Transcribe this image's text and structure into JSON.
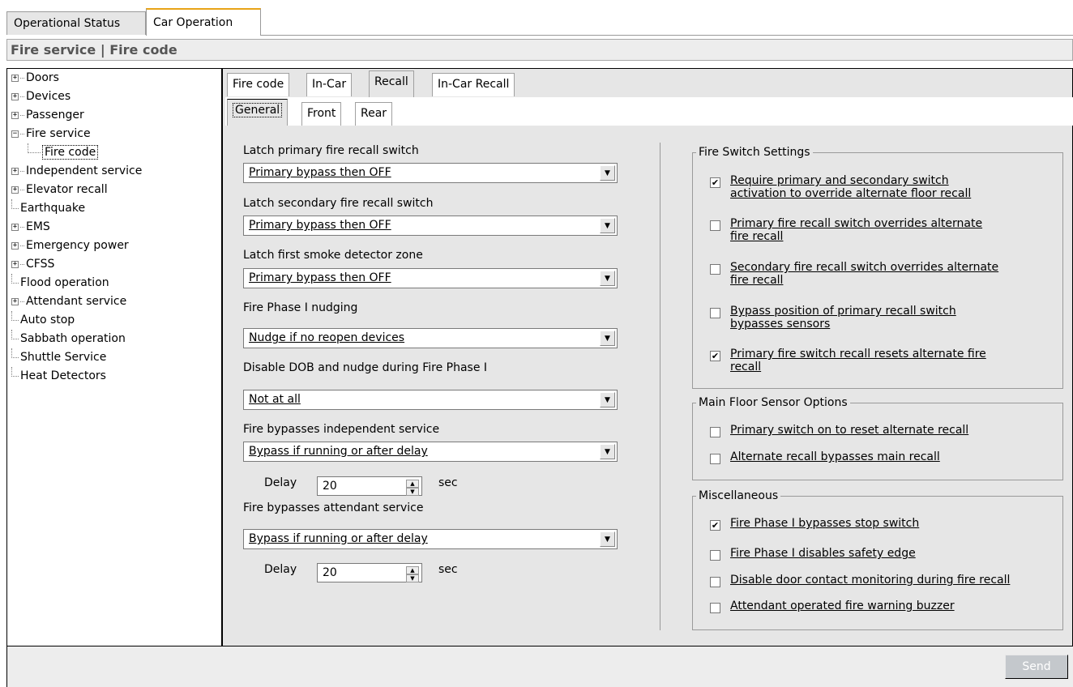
{
  "top_tabs": [
    {
      "label": "Operational Status",
      "active": false
    },
    {
      "label": "Car Operation",
      "active": true
    }
  ],
  "breadcrumb": "Fire service | Fire code",
  "tree": [
    {
      "label": "Doors",
      "kind": "expand"
    },
    {
      "label": "Devices",
      "kind": "expand"
    },
    {
      "label": "Passenger",
      "kind": "expand"
    },
    {
      "label": "Fire service",
      "kind": "collapse"
    },
    {
      "label": "Fire code",
      "kind": "child",
      "selected": true
    },
    {
      "label": "Independent service",
      "kind": "expand"
    },
    {
      "label": "Elevator recall",
      "kind": "expand"
    },
    {
      "label": "Earthquake",
      "kind": "leaf"
    },
    {
      "label": "EMS",
      "kind": "expand"
    },
    {
      "label": "Emergency power",
      "kind": "expand"
    },
    {
      "label": "CFSS",
      "kind": "expand"
    },
    {
      "label": "Flood operation",
      "kind": "leaf"
    },
    {
      "label": "Attendant service",
      "kind": "expand"
    },
    {
      "label": "Auto stop",
      "kind": "leaf"
    },
    {
      "label": "Sabbath operation",
      "kind": "leaf"
    },
    {
      "label": "Shuttle Service",
      "kind": "leaf"
    },
    {
      "label": "Heat Detectors",
      "kind": "leaf"
    }
  ],
  "tabs": [
    {
      "label": "Fire code",
      "active": false
    },
    {
      "label": "In-Car",
      "active": false
    },
    {
      "label": "Recall",
      "active": true
    },
    {
      "label": "In-Car Recall",
      "active": false
    }
  ],
  "subtabs": [
    {
      "label": "General",
      "active": true
    },
    {
      "label": "Front",
      "active": false
    },
    {
      "label": "Rear",
      "active": false
    }
  ],
  "settings": {
    "latch_primary": {
      "label": "Latch primary fire recall switch",
      "value": "Primary bypass then OFF"
    },
    "latch_secondary": {
      "label": "Latch secondary fire recall switch",
      "value": "Primary bypass then OFF"
    },
    "latch_smoke": {
      "label": "Latch first smoke detector zone",
      "value": "Primary bypass then OFF"
    },
    "nudging": {
      "label": "Fire Phase I nudging",
      "value": "Nudge if no reopen devices"
    },
    "disable_dob": {
      "label": "Disable DOB and nudge during Fire Phase I",
      "value": "Not at all"
    },
    "bypass_independent": {
      "label": "Fire bypasses independent service",
      "value": "Bypass if running or after delay"
    },
    "delay1": {
      "label": "Delay",
      "value": "20",
      "unit": "sec"
    },
    "bypass_attendant": {
      "label": "Fire bypasses attendant service",
      "value": "Bypass if running or after delay"
    },
    "delay2": {
      "label": "Delay",
      "value": "20",
      "unit": "sec"
    }
  },
  "fire_switch": {
    "title": "Fire Switch Settings",
    "items": [
      {
        "line1": "Require primary and secondary switch",
        "line2": "activation to override alternate floor recall",
        "checked": true
      },
      {
        "line1": "Primary fire recall switch overrides alternate",
        "line2": "fire recall",
        "checked": false
      },
      {
        "line1": "Secondary fire recall switch overrides alternate",
        "line2": "fire recall",
        "checked": false
      },
      {
        "line1": "Bypass position of primary recall switch",
        "line2": "bypasses sensors",
        "checked": false
      },
      {
        "line1": "Primary fire switch recall resets alternate fire",
        "line2": "recall",
        "checked": true
      }
    ]
  },
  "main_floor": {
    "title": "Main Floor Sensor Options",
    "items": [
      {
        "label": "Primary switch on to reset alternate recall",
        "checked": false
      },
      {
        "label": "Alternate recall bypasses main recall",
        "checked": false
      }
    ]
  },
  "misc": {
    "title": "Miscellaneous",
    "items": [
      {
        "label": "Fire Phase I bypasses stop switch",
        "checked": true
      },
      {
        "label": "Fire Phase I disables safety edge",
        "checked": false
      },
      {
        "label": "Disable door contact monitoring during fire recall",
        "checked": false
      },
      {
        "label": "Attendant operated fire warning buzzer",
        "checked": false
      }
    ]
  },
  "send_label": "Send",
  "check_mark": "✔"
}
